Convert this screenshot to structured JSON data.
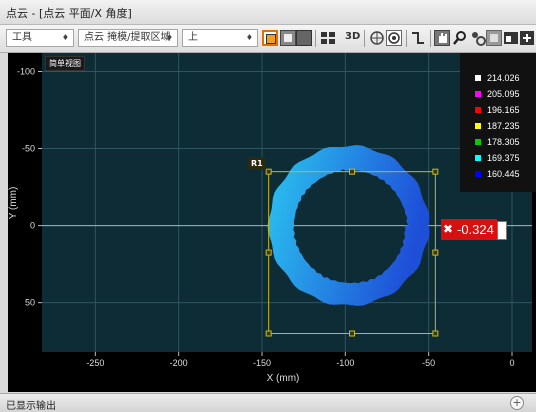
{
  "window": {
    "title": "点云 - [点云 平面/X 角度]"
  },
  "toolbar": {
    "tools_dropdown": "工具",
    "mode_dropdown": "点云 掩模/提取区域",
    "view_dropdown": "上",
    "label_3d": "3D"
  },
  "plot": {
    "view_badge": "简单视图",
    "roi_label": "R1",
    "measurement_value": "-0.324",
    "colors": {
      "background": "#0e2c35",
      "ring_light": "#2bc6f0",
      "ring_dark": "#1e4fd8",
      "roi": "#c8b820"
    }
  },
  "legend": {
    "entries": [
      {
        "value": "214.026",
        "color": "#ffffff"
      },
      {
        "value": "205.095",
        "color": "#ff00ff"
      },
      {
        "value": "196.165",
        "color": "#ff0000"
      },
      {
        "value": "187.235",
        "color": "#ffff00"
      },
      {
        "value": "178.305",
        "color": "#00cc00"
      },
      {
        "value": "169.375",
        "color": "#00ffff"
      },
      {
        "value": "160.445",
        "color": "#0000ff"
      }
    ]
  },
  "chart_data": {
    "type": "scatter",
    "xlabel": "X (mm)",
    "ylabel": "Y (mm)",
    "xlim": [
      -282,
      12
    ],
    "ylim": [
      -112,
      82
    ],
    "x_ticks": [
      -250,
      -200,
      -150,
      -100,
      -50,
      0
    ],
    "y_ticks": [
      -100,
      -50,
      0,
      50
    ],
    "series": [
      {
        "shape": "ring",
        "center": [
          -98,
          0
        ],
        "outer_radius": 48,
        "inner_radius": 36
      }
    ],
    "roi_rect": {
      "x": [
        -146,
        -46
      ],
      "y": [
        -35,
        70
      ]
    },
    "grid": true
  },
  "status": {
    "text": "已显示输出"
  }
}
